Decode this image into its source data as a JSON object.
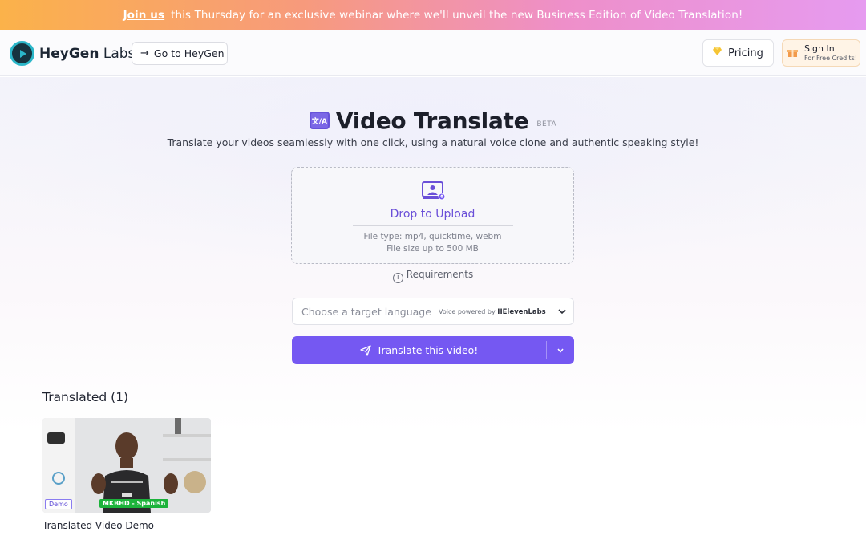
{
  "banner": {
    "join_link": "Join us",
    "message": "this Thursday for an exclusive webinar where we'll unveil the new Business Edition of Video Translation!"
  },
  "header": {
    "brand_bold": "HeyGen",
    "brand_light": " Labs",
    "goto_label": "Go to HeyGen",
    "pricing_label": "Pricing",
    "signin_label": "Sign In",
    "signin_sub": "For Free Credits!"
  },
  "hero": {
    "title": "Video Translate",
    "badge": "BETA",
    "subtitle": "Translate your videos seamlessly with one click, using a natural voice clone and authentic speaking style!"
  },
  "upload": {
    "label": "Drop to Upload",
    "file_type": "File type: mp4, quicktime, webm",
    "file_size": "File size up to 500 MB"
  },
  "requirements_label": "Requirements",
  "language_select": {
    "placeholder": "Choose a target language",
    "voice_prefix": "Voice powered by ",
    "voice_brand": "IIElevenLabs"
  },
  "translate_button": {
    "label": "Translate this video!"
  },
  "translated": {
    "heading": "Translated (1)",
    "items": [
      {
        "caption": "Translated Video Demo",
        "tag_demo": "Demo",
        "tag_lang": "MKBHD - Spanish"
      }
    ]
  },
  "colors": {
    "accent": "#7558f2",
    "accent_text": "#6a4fd8",
    "banner_start": "#fbb24a",
    "banner_end": "#e69bf0"
  },
  "icons": [
    "play-logo-icon",
    "arrow-right-icon",
    "diamond-icon",
    "gift-icon",
    "translate-icon",
    "upload-video-icon",
    "info-icon",
    "chevron-down-icon",
    "send-icon"
  ]
}
